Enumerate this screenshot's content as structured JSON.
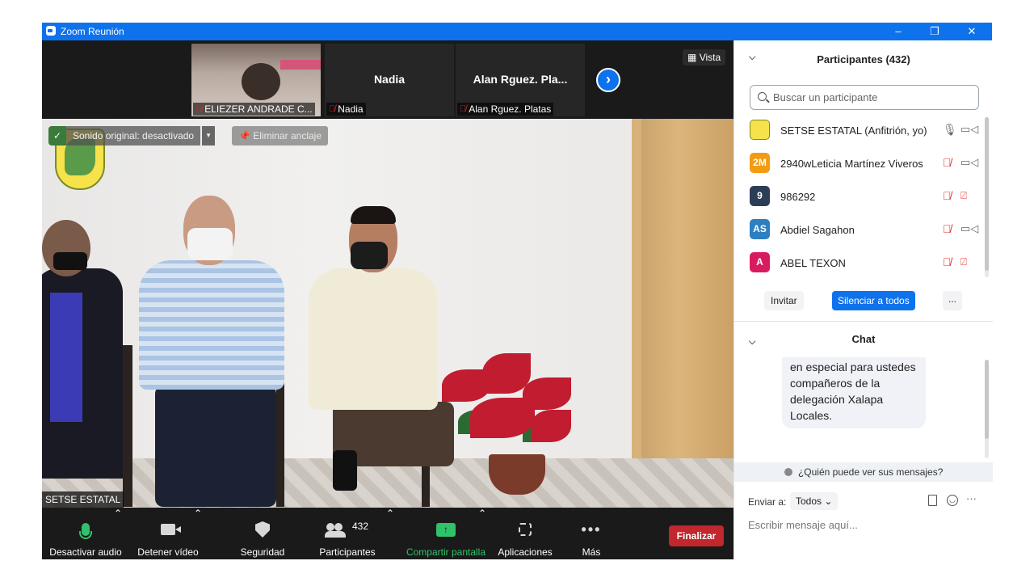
{
  "window": {
    "title": "Zoom Reunión",
    "minimize": "–",
    "restore": "❐",
    "close": "✕"
  },
  "strip": {
    "tiles": [
      {
        "name": "",
        "label": "ELIEZER ANDRADE C..."
      },
      {
        "name": "Nadia",
        "label": "Nadia"
      },
      {
        "name": "Alan  Rguez. Pla...",
        "label": "Alan  Rguez. Platas"
      }
    ],
    "next_glyph": "›",
    "view_label": "Vista"
  },
  "video": {
    "original_sound": "Sonido original: desactivado",
    "unpin": "Eliminar anclaje",
    "speaker_name": "SETSE ESTATAL"
  },
  "toolbar": {
    "mute": "Desactivar audio",
    "stop_video": "Detener vídeo",
    "security": "Seguridad",
    "participants": "Participantes",
    "participants_count": "432",
    "share": "Compartir pantalla",
    "apps": "Aplicaciones",
    "more": "Más",
    "end": "Finalizar"
  },
  "participants_panel": {
    "title": "Participantes (432)",
    "search_placeholder": "Buscar un participante",
    "list": [
      {
        "avatar": "",
        "avatar_color": "#f6e24a",
        "name": "SETSE ESTATAL (Anfitrión, yo)",
        "muted": false,
        "video_off": false
      },
      {
        "avatar": "2M",
        "avatar_color": "#f39c12",
        "name": "2940wLeticia Martínez Viveros",
        "muted": true,
        "video_off": false
      },
      {
        "avatar": "9",
        "avatar_color": "#2c3e57",
        "name": "986292",
        "muted": true,
        "video_off": true
      },
      {
        "avatar": "AS",
        "avatar_color": "#2d7fc1",
        "name": "Abdiel Sagahon",
        "muted": true,
        "video_off": false
      },
      {
        "avatar": "A",
        "avatar_color": "#d81b60",
        "name": "ABEL TEXON",
        "muted": true,
        "video_off": true
      }
    ],
    "invite": "Invitar",
    "mute_all": "Silenciar a todos",
    "more": "..."
  },
  "chat": {
    "title": "Chat",
    "message": "en especial para ustedes compañeros de la delegación Xalapa Locales.",
    "who_can_see": "¿Quién puede ver sus mensajes?",
    "send_to_label": "Enviar a:",
    "send_to_value": "Todos",
    "placeholder": "Escribir mensaje aquí..."
  },
  "colors": {
    "zoom_blue": "#0e72ed",
    "end_red": "#c1272d",
    "active_green": "#2fc26b",
    "mute_red": "#e02828"
  }
}
